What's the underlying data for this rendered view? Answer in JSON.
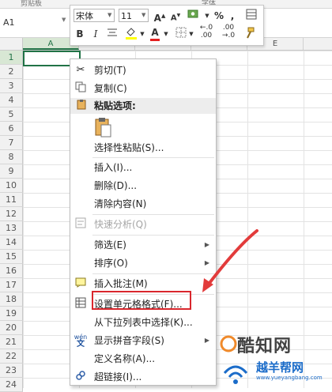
{
  "ribbon": {
    "left_label": "剪贴板",
    "right_label": "字体"
  },
  "namebox": {
    "value": "A1"
  },
  "columns": [
    {
      "label": "A",
      "selected": true
    },
    {
      "label": "B",
      "selected": false
    },
    {
      "label": "C",
      "selected": false
    },
    {
      "label": "D",
      "selected": false
    },
    {
      "label": "E",
      "selected": false
    }
  ],
  "rows": [
    "1",
    "2",
    "3",
    "4",
    "5",
    "6",
    "7",
    "8",
    "9",
    "10",
    "11",
    "12",
    "13",
    "14",
    "15",
    "16",
    "17",
    "18",
    "19",
    "20",
    "21",
    "22",
    "23",
    "24"
  ],
  "mini_toolbar": {
    "font_name": "宋体",
    "font_size": "11",
    "grow_font": "A",
    "shrink_font": "A",
    "percent": "%",
    "comma": ",",
    "bold": "B",
    "italic": "I",
    "font_color": "A",
    "dec_increase": "←.0",
    "dec_increase_sub": ".00",
    "dec_decrease": ".00",
    "dec_decrease_sub": "→.0"
  },
  "context_menu": {
    "cut": "剪切(T)",
    "copy": "复制(C)",
    "paste_options": "粘贴选项:",
    "paste_special": "选择性粘贴(S)...",
    "insert": "插入(I)...",
    "delete": "删除(D)...",
    "clear_contents": "清除内容(N)",
    "quick_analysis": "快速分析(Q)",
    "filter": "筛选(E)",
    "sort": "排序(O)",
    "insert_comment": "插入批注(M)",
    "format_cells": "设置单元格格式(F)...",
    "pick_from_list": "从下拉列表中选择(K)...",
    "show_phonetic": "显示拼音字段(S)",
    "phonetic_icon": "wén",
    "define_name": "定义名称(A)...",
    "hyperlink": "超链接(I)..."
  },
  "watermark": {
    "brand": "酷知网",
    "site": "越羊帮网",
    "url": "www.yueyangbang.com"
  },
  "colors": {
    "accent": "#217346",
    "highlight": "#d9272d",
    "arrow": "#e23b3b",
    "watermark": "#1b6cc9"
  }
}
